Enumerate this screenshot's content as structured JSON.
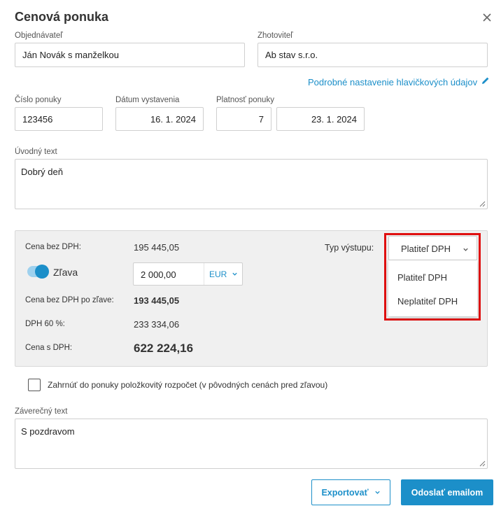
{
  "dialog": {
    "title": "Cenová ponuka"
  },
  "header": {
    "client_label": "Objednávateľ",
    "client_value": "Ján Novák s manželkou",
    "contractor_label": "Zhotoviteľ",
    "contractor_value": "Ab stav s.r.o.",
    "details_link": "Podrobné nastavenie hlavičkových údajov"
  },
  "meta": {
    "number_label": "Číslo ponuky",
    "number_value": "123456",
    "issue_label": "Dátum vystavenia",
    "issue_value": "16. 1. 2024",
    "validity_label": "Platnosť ponuky",
    "validity_days": "7",
    "validity_date": "23. 1. 2024"
  },
  "intro": {
    "label": "Úvodný text",
    "value": "Dobrý deň"
  },
  "summary": {
    "price_excl_label": "Cena bez DPH:",
    "price_excl_value": "195 445,05",
    "discount_label": "Zľava",
    "discount_enabled": true,
    "discount_value": "2 000,00",
    "discount_currency": "EUR",
    "after_discount_label": "Cena bez DPH po zľave:",
    "after_discount_value": "193 445,05",
    "vat_label": "DPH 60 %:",
    "vat_value": "233 334,06",
    "total_label": "Cena s DPH:",
    "total_value": "622 224,16",
    "output_type_label": "Typ výstupu:",
    "output_type_selected": "Platiteľ DPH",
    "output_type_options": [
      "Platiteľ DPH",
      "Neplatiteľ DPH"
    ]
  },
  "include_budget": {
    "label": "Zahrnúť do ponuky položkovitý rozpočet (v pôvodných cenách pred zľavou)",
    "checked": false
  },
  "closing": {
    "label": "Záverečný text",
    "value": "S pozdravom"
  },
  "actions": {
    "export_label": "Exportovať",
    "send_label": "Odoslať emailom"
  },
  "colors": {
    "accent": "#1c8fc9",
    "highlight": "#e01010",
    "panel_bg": "#f0f0f0"
  }
}
